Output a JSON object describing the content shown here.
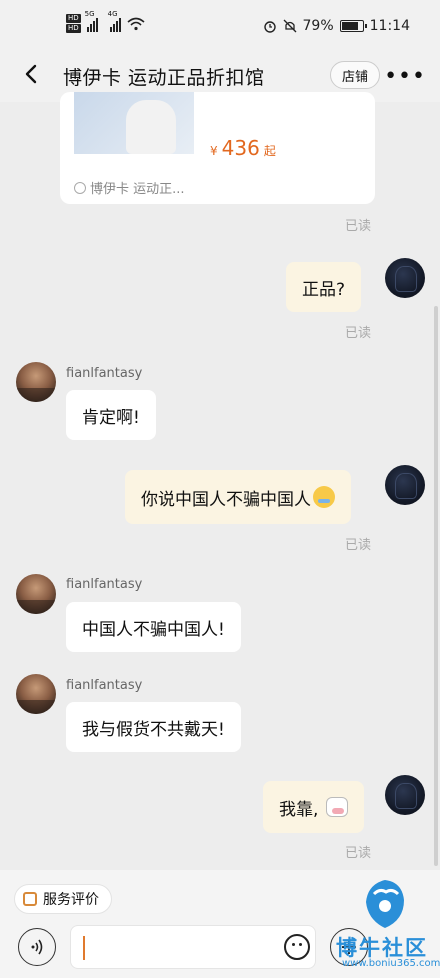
{
  "status_bar": {
    "hd1": "HD",
    "hd2": "HD",
    "net1": "5G",
    "net2": "4G",
    "battery": "79%",
    "time": "11:14"
  },
  "nav": {
    "title": "博伊卡 运动正品折扣馆",
    "shop_button": "店铺"
  },
  "product_card": {
    "currency": "¥",
    "price": "436",
    "price_suffix": "起",
    "shop_name": "博伊卡 运动正..."
  },
  "read_label": "已读",
  "messages": [
    {
      "side": "mine",
      "text": "正品?"
    },
    {
      "side": "other",
      "username": "fianlfantasy",
      "text": "肯定啊!"
    },
    {
      "side": "mine",
      "text": "你说中国人不骗中国人",
      "emoji": "crying-face-icon"
    },
    {
      "side": "other",
      "username": "fianlfantasy",
      "text": "中国人不骗中国人!"
    },
    {
      "side": "other",
      "username": "fianlfantasy",
      "text": "我与假货不共戴天!"
    },
    {
      "side": "mine",
      "text": "我靠,",
      "emoji": "cow-face-icon"
    }
  ],
  "bottom": {
    "service_chip": "服务评价",
    "input_value": ""
  },
  "watermark": {
    "text": "博牛社区",
    "url": "www.boniu365.com"
  },
  "colors": {
    "accent_price": "#e2681f",
    "my_bubble": "#fbf4e2",
    "other_bubble": "#ffffff",
    "watermark": "#2a8fd8"
  }
}
